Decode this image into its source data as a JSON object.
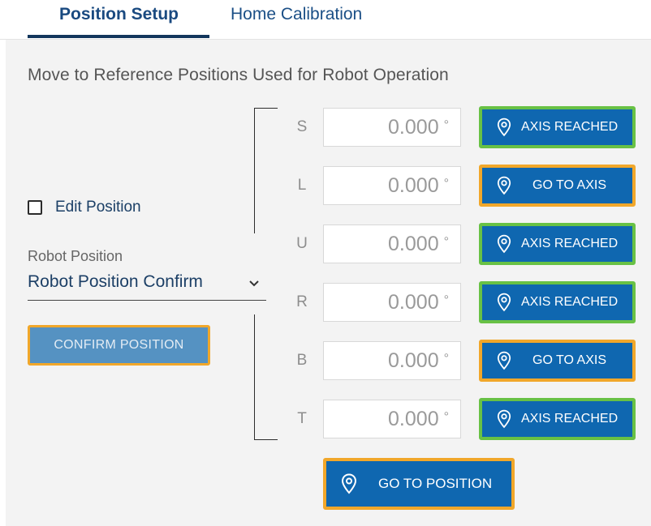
{
  "tabs": [
    {
      "label": "Position Setup",
      "active": true
    },
    {
      "label": "Home Calibration",
      "active": false
    }
  ],
  "heading": "Move to Reference Positions Used for Robot Operation",
  "edit_position": {
    "label": "Edit Position",
    "checked": false
  },
  "robot_position": {
    "label": "Robot Position",
    "value": "Robot Position Confirm"
  },
  "confirm_button": "CONFIRM POSITION",
  "axes": [
    {
      "name": "S",
      "value": "0.000",
      "unit": "°",
      "button": "AXIS REACHED",
      "status": "reached"
    },
    {
      "name": "L",
      "value": "0.000",
      "unit": "°",
      "button": "GO TO AXIS",
      "status": "goto"
    },
    {
      "name": "U",
      "value": "0.000",
      "unit": "°",
      "button": "AXIS REACHED",
      "status": "reached"
    },
    {
      "name": "R",
      "value": "0.000",
      "unit": "°",
      "button": "AXIS REACHED",
      "status": "reached"
    },
    {
      "name": "B",
      "value": "0.000",
      "unit": "°",
      "button": "GO TO AXIS",
      "status": "goto"
    },
    {
      "name": "T",
      "value": "0.000",
      "unit": "°",
      "button": "AXIS REACHED",
      "status": "reached"
    }
  ],
  "go_to_position": "GO TO POSITION",
  "colors": {
    "primary": "#0f67b0",
    "reached_border": "#68c145",
    "goto_border": "#f1a72a",
    "tab_active": "#1a4a80"
  },
  "icons": {
    "pin": "location-pin-icon",
    "chevron": "chevron-down-icon"
  }
}
